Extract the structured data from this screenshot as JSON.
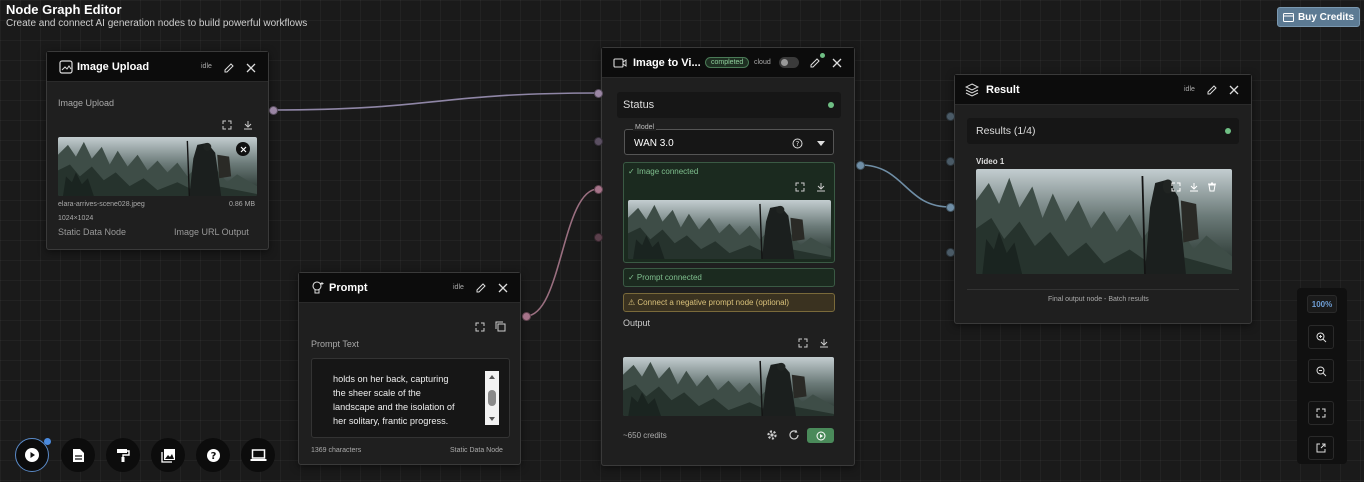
{
  "app": {
    "title": "Node Graph Editor",
    "subtitle": "Create and connect AI generation nodes to build powerful workflows",
    "buy_credits": "Buy Credits"
  },
  "upload_node": {
    "title": "Image Upload",
    "status": "idle",
    "section_label": "Image Upload",
    "file_name": "elara-arrives-scene028.jpeg",
    "file_size": "0.86 MB",
    "dimensions": "1024×1024",
    "footer_left": "Static Data Node",
    "footer_right": "Image URL Output"
  },
  "prompt_node": {
    "title": "Prompt",
    "status": "idle",
    "section_label": "Prompt Text",
    "text_lines": [
      "holds on her back, capturing",
      "the sheer scale of the",
      "landscape and the isolation of",
      "her solitary, frantic progress."
    ],
    "char_count": "1369 characters",
    "footer_right": "Static Data Node"
  },
  "video_node": {
    "title": "Image to Vi...",
    "status_badge": "completed",
    "cloud_label": "cloud",
    "status_label": "Status",
    "model_label": "Model",
    "model_value": "WAN 3.0",
    "image_connected": "✓ Image connected",
    "prompt_connected": "✓ Prompt connected",
    "negative_prompt": "⚠ Connect a negative prompt node (optional)",
    "output_label": "Output",
    "credits": "~650 credits"
  },
  "result_node": {
    "title": "Result",
    "status": "idle",
    "results_label": "Results (1/4)",
    "video_label": "Video 1",
    "footer": "Final output node - Batch results"
  },
  "zoom": {
    "level": "100%"
  },
  "icons": [
    "image-icon",
    "edit-icon",
    "close-icon",
    "expand-icon",
    "download-icon",
    "lightbulb-icon",
    "copy-icon",
    "video-icon",
    "help-icon",
    "chevron-down-icon",
    "gear-icon",
    "refresh-icon",
    "run-icon",
    "layers-icon",
    "trash-icon",
    "zoom-in-icon",
    "zoom-out-icon",
    "fit-icon",
    "external-icon",
    "play-icon",
    "document-icon",
    "paint-roller-icon",
    "gallery-icon",
    "question-icon",
    "monitor-icon"
  ],
  "colors": {
    "background": "#1a1a1a",
    "node_header": "#0c0c0c",
    "accent_green": "#4a8a5a",
    "buy_button": "#5c7a93",
    "port_image": "#9a86a4",
    "port_prompt": "#a57389",
    "zoom_text": "#6f9fd6"
  }
}
